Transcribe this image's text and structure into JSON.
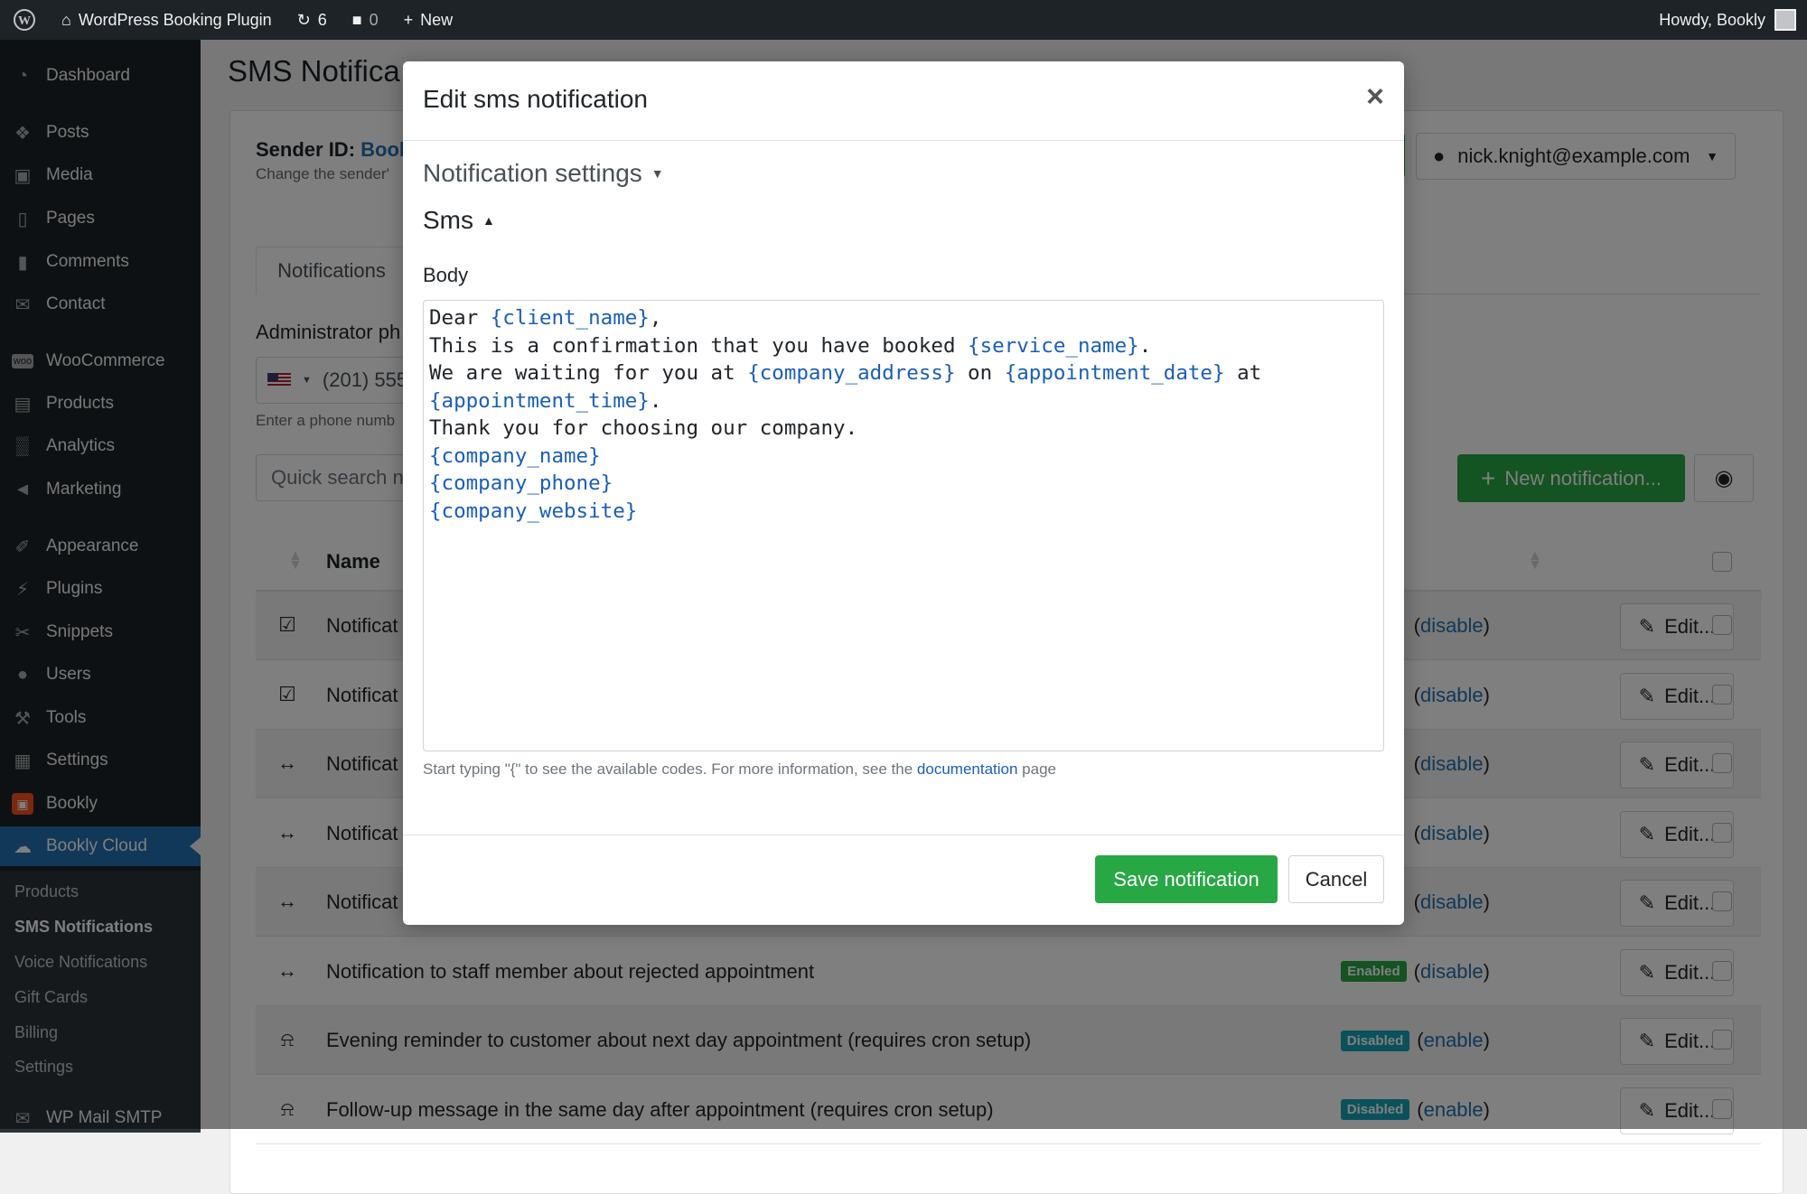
{
  "admin_bar": {
    "site_name": "WordPress Booking Plugin",
    "updates_count": "6",
    "comments_count": "0",
    "new_label": "New",
    "howdy": "Howdy, Bookly"
  },
  "sidebar": {
    "items": [
      {
        "label": "Dashboard",
        "icon": "dashboard-icon"
      },
      {
        "label": "Posts",
        "icon": "pin-icon"
      },
      {
        "label": "Media",
        "icon": "media-icon"
      },
      {
        "label": "Pages",
        "icon": "pages-icon"
      },
      {
        "label": "Comments",
        "icon": "comment-icon"
      },
      {
        "label": "Contact",
        "icon": "mail-icon"
      },
      {
        "label": "WooCommerce",
        "icon": "woo-icon"
      },
      {
        "label": "Products",
        "icon": "archive-icon"
      },
      {
        "label": "Analytics",
        "icon": "bar-chart-icon"
      },
      {
        "label": "Marketing",
        "icon": "megaphone-icon"
      },
      {
        "label": "Appearance",
        "icon": "brush-icon"
      },
      {
        "label": "Plugins",
        "icon": "plug-icon"
      },
      {
        "label": "Snippets",
        "icon": "scissors-icon"
      },
      {
        "label": "Users",
        "icon": "user-icon"
      },
      {
        "label": "Tools",
        "icon": "wrench-icon"
      },
      {
        "label": "Settings",
        "icon": "settings-icon"
      },
      {
        "label": "Bookly",
        "icon": "bookly-icon"
      },
      {
        "label": "Bookly Cloud",
        "icon": "cloud-icon"
      }
    ],
    "submenu": [
      "Products",
      "SMS Notifications",
      "Voice Notifications",
      "Gift Cards",
      "Billing",
      "Settings"
    ],
    "bottom_item": "WP Mail SMTP"
  },
  "page": {
    "title": "SMS Notifica",
    "sender_label": "Sender ID:",
    "sender_value": "Bool",
    "sender_help": "Change the sender'",
    "account": "nick.knight@example.com",
    "tab": "Notifications",
    "admin_phone_label": "Administrator ph",
    "phone_value": "(201) 555",
    "phone_help": "Enter a phone numb",
    "search_placeholder": "Quick search n",
    "new_notification": "New notification...",
    "col_name": "Name",
    "rows": [
      {
        "icon": "calendar-check-icon",
        "name": "Notificat",
        "badge": "",
        "link": "disable"
      },
      {
        "icon": "calendar-check-icon",
        "name": "Notificat",
        "badge": "",
        "link": "disable"
      },
      {
        "icon": "arrows-horizontal-icon",
        "name": "Notificat",
        "badge": "",
        "link": "disable"
      },
      {
        "icon": "arrows-horizontal-icon",
        "name": "Notificat",
        "badge": "",
        "link": "disable"
      },
      {
        "icon": "arrows-horizontal-icon",
        "name": "Notificat",
        "badge": "",
        "link": "disable"
      },
      {
        "icon": "arrows-horizontal-icon",
        "name": "Notification to staff member about rejected appointment",
        "badge": "Enabled",
        "link": "disable"
      },
      {
        "icon": "bell-icon",
        "name": "Evening reminder to customer about next day appointment (requires cron setup)",
        "badge": "Disabled",
        "link": "enable"
      },
      {
        "icon": "bell-icon",
        "name": "Follow-up message in the same day after appointment (requires cron setup)",
        "badge": "Disabled",
        "link": "enable"
      }
    ],
    "edit_label": "Edit..."
  },
  "modal": {
    "title": "Edit sms notification",
    "section_settings": "Notification settings",
    "section_sms": "Sms",
    "body_label": "Body",
    "body_lines": [
      [
        {
          "t": "Dear "
        },
        {
          "c": "{client_name}"
        },
        {
          "t": ","
        }
      ],
      [
        {
          "t": "This is a confirmation that you have booked "
        },
        {
          "c": "{service_name}"
        },
        {
          "t": "."
        }
      ],
      [
        {
          "t": "We are waiting for you at "
        },
        {
          "c": "{company_address}"
        },
        {
          "t": " on "
        },
        {
          "c": "{appointment_date}"
        },
        {
          "t": " at"
        }
      ],
      [
        {
          "c": "{appointment_time}"
        },
        {
          "t": "."
        }
      ],
      [
        {
          "t": "Thank you for choosing our company."
        }
      ],
      [
        {
          "c": "{company_name}"
        }
      ],
      [
        {
          "c": "{company_phone}"
        }
      ],
      [
        {
          "c": "{company_website}"
        }
      ]
    ],
    "help_before": "Start typing \"{\" to see the available codes. For more information, see the ",
    "help_link": "documentation",
    "help_after": " page",
    "save": "Save notification",
    "cancel": "Cancel"
  },
  "colors": {
    "wp_dark": "#1d2327",
    "wp_blue": "#2271b1",
    "success": "#28a745",
    "info": "#17a2b8",
    "code": "#1a5eb8"
  }
}
